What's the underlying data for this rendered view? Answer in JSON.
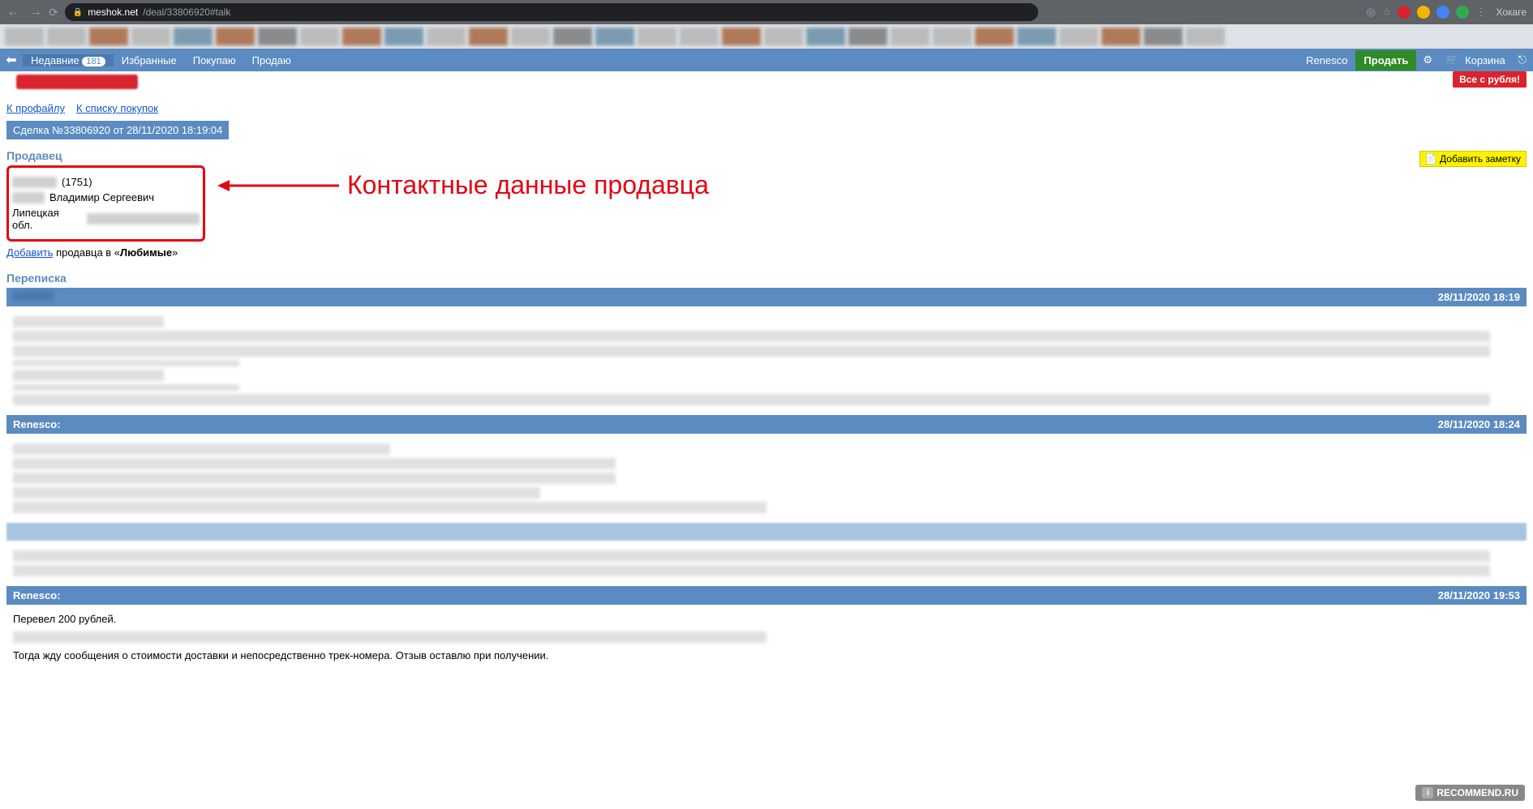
{
  "browser": {
    "url_domain": "meshok.net",
    "url_path": "/deal/33806920#talk",
    "user": "Хокаге"
  },
  "nav": {
    "recent": "Недавние",
    "recent_count": "181",
    "favorites": "Избранные",
    "buying": "Покупаю",
    "selling": "Продаю",
    "username": "Renesco",
    "sell_btn": "Продать",
    "cart": "Корзина"
  },
  "red_badge": "Все с рубля!",
  "links": {
    "profile": "К профайлу",
    "purchases": "К списку покупок"
  },
  "deal": {
    "header": "Сделка №33806920 от 28/11/2020 18:19:04"
  },
  "seller": {
    "title": "Продавец",
    "rating": "(1751)",
    "name": "Владимир Сергеевич",
    "region": "Липецкая обл.",
    "add_link": "Добавить",
    "add_text": " продавца в «",
    "add_fav": "Любимые",
    "add_close": "»"
  },
  "annotation": "Контактные данные продавца",
  "add_note": "Добавить заметку",
  "chat": {
    "title": "Переписка",
    "messages": [
      {
        "author": "",
        "time": "28/11/2020 18:19"
      },
      {
        "author": "Renesco:",
        "time": "28/11/2020 18:24"
      },
      {
        "author": "Renesco:",
        "time": "28/11/2020 19:53"
      }
    ],
    "msg3_line1": "Перевел 200 рублей.",
    "msg3_line2": "Тогда жду сообщения о стоимости доставки и непосредственно трек-номера. Отзыв оставлю при получении."
  },
  "watermark": "RECOMMEND.RU"
}
